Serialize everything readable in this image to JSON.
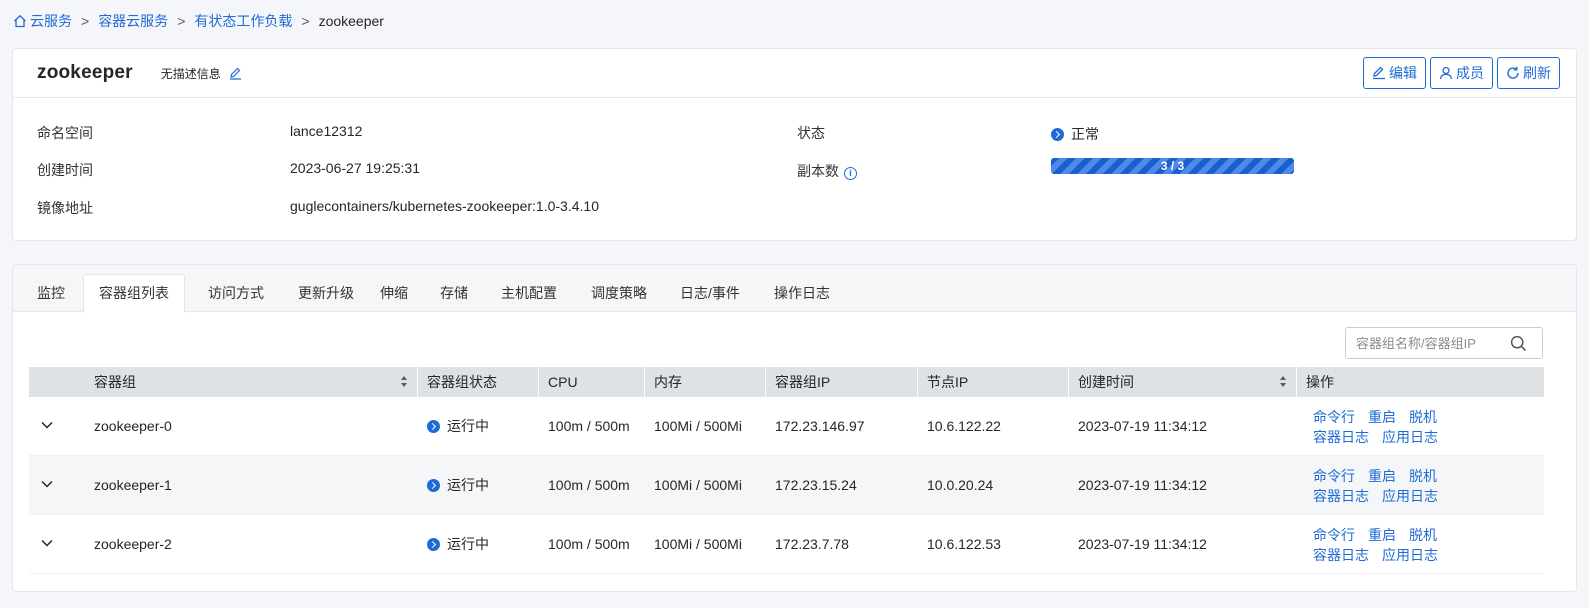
{
  "breadcrumb": {
    "items": [
      "云服务",
      "容器云服务",
      "有状态工作负载"
    ],
    "current": "zookeeper",
    "separator": ">"
  },
  "header": {
    "title": "zookeeper",
    "description": "无描述信息",
    "buttons": {
      "edit": "编辑",
      "members": "成员",
      "refresh": "刷新"
    }
  },
  "info": {
    "namespace_label": "命名空间",
    "namespace_value": "lance12312",
    "created_label": "创建时间",
    "created_value": "2023-06-27 19:25:31",
    "image_label": "镜像地址",
    "image_value": "guglecontainers/kubernetes-zookeeper:1.0-3.4.10",
    "status_label": "状态",
    "status_value": "正常",
    "replicas_label": "副本数",
    "replicas_text": "3 / 3",
    "replicas_ready": 3,
    "replicas_total": 3
  },
  "tabs": [
    "监控",
    "容器组列表",
    "访问方式",
    "更新升级",
    "伸缩",
    "存储",
    "主机配置",
    "调度策略",
    "日志/事件",
    "操作日志"
  ],
  "active_tab": "容器组列表",
  "search": {
    "placeholder": "容器组名称/容器组IP"
  },
  "table": {
    "columns": [
      "容器组",
      "容器组状态",
      "CPU",
      "内存",
      "容器组IP",
      "节点IP",
      "创建时间",
      "操作"
    ],
    "rows": [
      {
        "name": "zookeeper-0",
        "status": "运行中",
        "cpu": "100m / 500m",
        "memory": "100Mi / 500Mi",
        "pod_ip": "172.23.146.97",
        "node_ip": "10.6.122.22",
        "created": "2023-07-19 11:34:12"
      },
      {
        "name": "zookeeper-1",
        "status": "运行中",
        "cpu": "100m / 500m",
        "memory": "100Mi / 500Mi",
        "pod_ip": "172.23.15.24",
        "node_ip": "10.0.20.24",
        "created": "2023-07-19 11:34:12"
      },
      {
        "name": "zookeeper-2",
        "status": "运行中",
        "cpu": "100m / 500m",
        "memory": "100Mi / 500Mi",
        "pod_ip": "172.23.7.78",
        "node_ip": "10.6.122.53",
        "created": "2023-07-19 11:34:12"
      }
    ],
    "actions": {
      "shell": "命令行",
      "restart": "重启",
      "detach": "脱机",
      "container_log": "容器日志",
      "app_log": "应用日志"
    }
  },
  "colors": {
    "accent": "#1f6bd6",
    "header_bg": "#dfe2e5",
    "page_bg": "#f4f6f9"
  }
}
